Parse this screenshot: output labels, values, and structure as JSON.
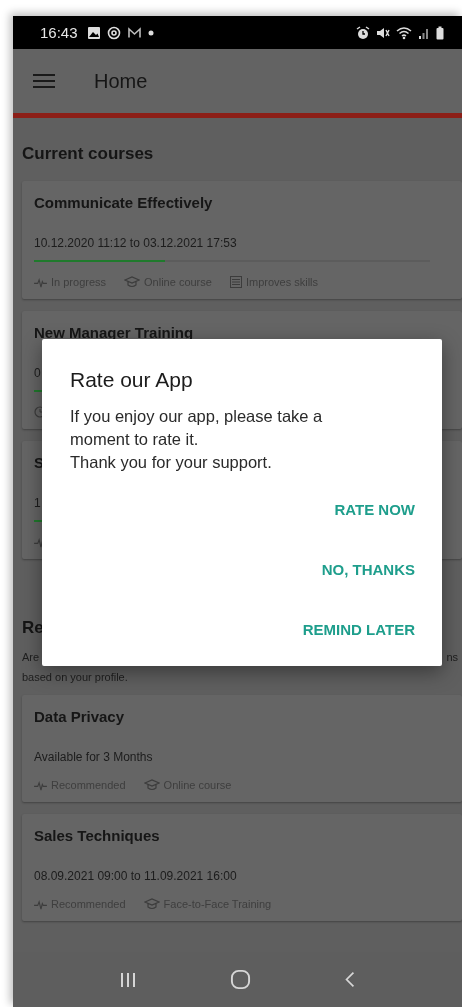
{
  "status_bar": {
    "time": "16:43"
  },
  "app_bar": {
    "title": "Home"
  },
  "sections": [
    {
      "heading": "Current courses",
      "courses": [
        {
          "title": "Communicate Effectively",
          "detail": "10.12.2020 11:12 to 03.12.2021 17:53",
          "level": 0.33,
          "tags": [
            {
              "kind": "pulse",
              "label": "In progress"
            },
            {
              "kind": "cap",
              "label": "Online course"
            },
            {
              "kind": "list",
              "label": "Improves skills"
            }
          ]
        },
        {
          "title": "New Manager Training",
          "detail": "0",
          "level": 0.02,
          "tags": [
            {
              "kind": "clock"
            }
          ]
        },
        {
          "title": "S",
          "detail": "1",
          "level": 0.02,
          "tags": [
            {
              "kind": "pulse"
            }
          ]
        }
      ]
    },
    {
      "heading": "Re",
      "intro_start": "Are",
      "intro_end": "ns",
      "intro_line_2": "based on your profile.",
      "courses": [
        {
          "title": "Data Privacy",
          "detail": "Available for 3 Months",
          "tags": [
            {
              "kind": "pulse",
              "label": "Recommended"
            },
            {
              "kind": "cap",
              "label": "Online course"
            }
          ]
        },
        {
          "title": "Sales Techniques",
          "detail": "08.09.2021 09:00 to 11.09.2021 16:00",
          "tags": [
            {
              "kind": "pulse",
              "label": "Recommended"
            },
            {
              "kind": "cap",
              "label": "Face-to-Face Training"
            }
          ]
        }
      ]
    }
  ],
  "dialog": {
    "title": "Rate our App",
    "message": "If you enjoy our app, please take a moment to rate it.\nThank you for your support.",
    "buttons": [
      "RATE NOW",
      "NO, THANKS",
      "REMIND LATER"
    ]
  }
}
